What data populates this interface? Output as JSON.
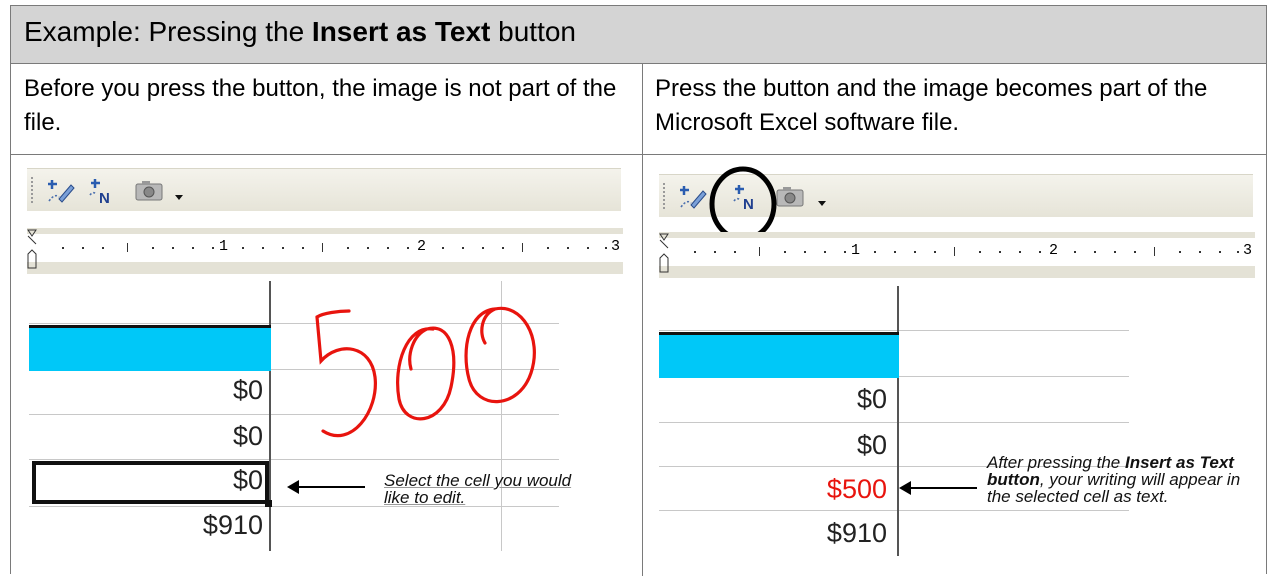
{
  "header": {
    "title_prefix": "Example: Pressing the ",
    "title_bold": "Insert as Text",
    "title_suffix": " button"
  },
  "left": {
    "description": "Before you press the button, the image is not part of the file.",
    "ruler_numbers": [
      "1",
      "2",
      "3"
    ],
    "cells": [
      "$0",
      "$0",
      "$0",
      "$910"
    ],
    "handwriting": "500",
    "note": "Select the cell you would like to edit."
  },
  "right": {
    "description": "Press the button and the image becomes part of the Microsoft Excel software file.",
    "ruler_numbers": [
      "1",
      "2",
      "3"
    ],
    "cells": [
      "$0",
      "$0",
      "$500",
      "$910"
    ],
    "note_prefix": "After pressing the ",
    "note_bold": "Insert as Text button",
    "note_suffix": ", your writing will appear in the selected cell as text."
  },
  "icons": [
    "ink-pen-icon",
    "insert-as-text-icon",
    "camera-icon",
    "dropdown-arrow-icon"
  ],
  "colors": {
    "header_bg": "#d4d4d4",
    "selected_row": "#00c8f8",
    "handwriting": "#e8140e",
    "inserted_value": "#e8140e",
    "highlight_circle": "#000000"
  }
}
